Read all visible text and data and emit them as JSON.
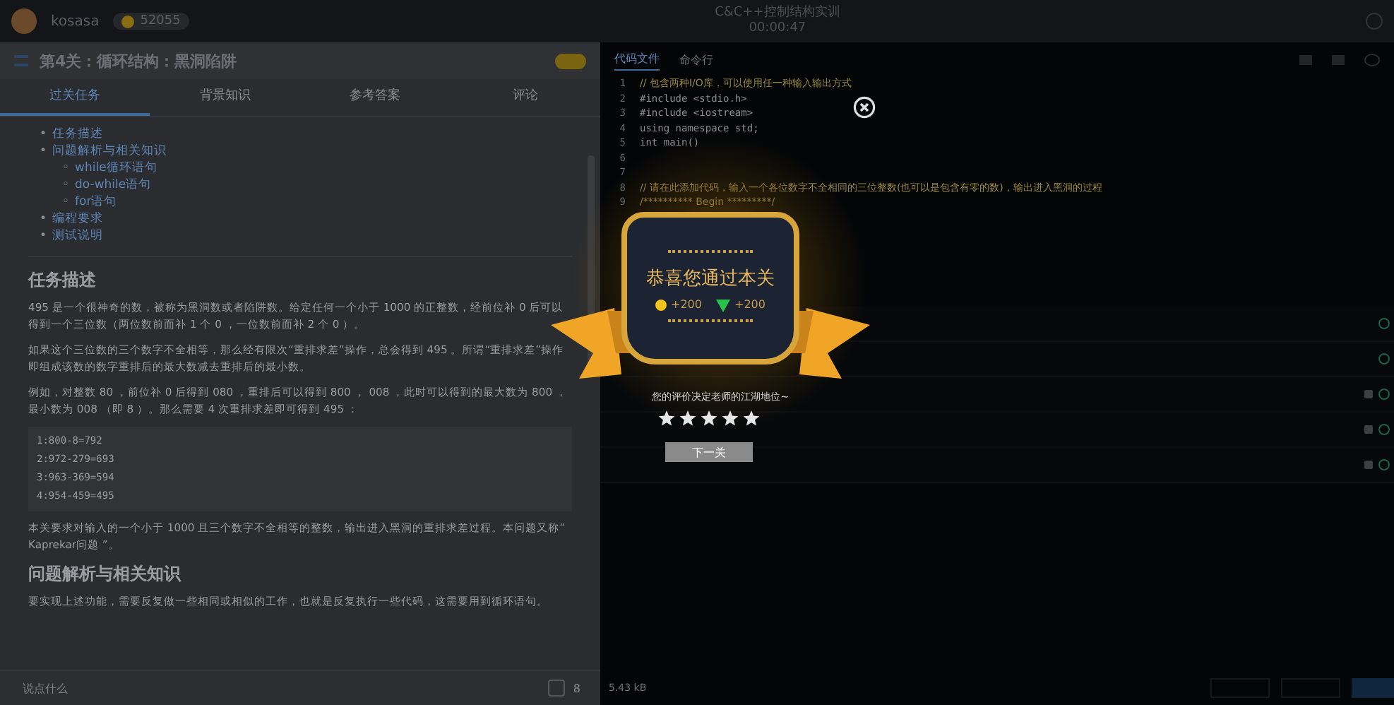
{
  "top_bar": {
    "user": "kosasa",
    "coins": "52055",
    "course_title": "C&C++控制结构实训",
    "timer": "00:00:47"
  },
  "task_panel": {
    "title": "第4关：循环结构：黑洞陷阱",
    "tabs": [
      {
        "label": "过关任务",
        "selected": true
      },
      {
        "label": "背景知识",
        "selected": false
      },
      {
        "label": "参考答案",
        "selected": false
      },
      {
        "label": "评论",
        "selected": false
      }
    ],
    "toc": [
      {
        "bullet": "•",
        "label": "任务描述"
      },
      {
        "bullet": "•",
        "label": "问题解析与相关知识",
        "children": [
          {
            "bullet": "◦",
            "label": "while循环语句"
          },
          {
            "bullet": "◦",
            "label": "do-while语句"
          },
          {
            "bullet": "◦",
            "label": "for语句"
          }
        ]
      },
      {
        "bullet": "•",
        "label": "编程要求"
      },
      {
        "bullet": "•",
        "label": "测试说明"
      }
    ],
    "content": [
      {
        "kind": "heading",
        "text": "任务描述"
      },
      {
        "kind": "para",
        "text": "495 是一个很神奇的数，被称为黑洞数或者陷阱数。给定任何一个小于 1000 的正整数，经前位补 0 后可以得到一个三位数（两位数前面补 1 个 0 ，一位数前面补 2 个 0 ）。"
      },
      {
        "kind": "para",
        "text": "如果这个三位数的三个数字不全相等，那么经有限次“重排求差”操作，总会得到 495 。所谓“重排求差”操作即组成该数的数字重排后的最大数减去重排后的最小数。"
      },
      {
        "kind": "para",
        "text": "例如，对整数 80 ，前位补 0 后得到 080 ，重排后可以得到 800 ， 008 ，此时可以得到的最大数为 800 ，最小数为 008 （即 8 ）。那么需要 4 次重排求差即可得到 495 ："
      },
      {
        "kind": "code",
        "lines": [
          "1:800-8=792",
          "2:972-279=693",
          "3:963-369=594",
          "4:954-459=495"
        ]
      },
      {
        "kind": "para",
        "text": "本关要求对输入的一个小于 1000 且三个数字不全相等的整数，输出进入黑洞的重排求差过程。本问题又称“ Kaprekar问题 ”。"
      },
      {
        "kind": "heading",
        "text": "问题解析与相关知识"
      },
      {
        "kind": "para",
        "text": "要实现上述功能，需要反复做一些相同或相似的工作，也就是反复执行一些代码，这需要用到循环语句。"
      }
    ],
    "comment": {
      "placeholder": "说点什么"
    },
    "likes": "8"
  },
  "editor": {
    "tabs": [
      {
        "label": "代码文件",
        "selected": true
      },
      {
        "label": "命令行",
        "selected": false
      }
    ],
    "code": [
      {
        "number": "1",
        "text": "// 包含两种I/O库，可以使用任一种输入输出方式"
      },
      {
        "number": "2",
        "text": "#include <stdio.h>"
      },
      {
        "number": "3",
        "text": "#include <iostream>"
      },
      {
        "number": "4",
        "text": "using namespace std;"
      },
      {
        "number": "5",
        "text": "int main()"
      },
      {
        "number": "6"
      },
      {
        "number": "7"
      },
      {
        "number": "8",
        "text": "// 请在此添加代码，输入一个各位数字不全相同的三位整数(也可以是包含有零的数)，输出进入黑洞的过程"
      },
      {
        "number": "9",
        "text": "/********** Begin *********/"
      }
    ],
    "tests": [
      {
        "locked": false
      },
      {
        "locked": false
      },
      {
        "locked": true
      },
      {
        "locked": true
      },
      {
        "locked": true
      }
    ],
    "file_size": "5.43 kB"
  },
  "dialog": {
    "title": "恭喜您通过本关",
    "coins": "+200",
    "exp": "+200",
    "rating_prompt": "您的评价决定老师的江湖地位~",
    "stars": 5,
    "next_button": "下一关"
  }
}
